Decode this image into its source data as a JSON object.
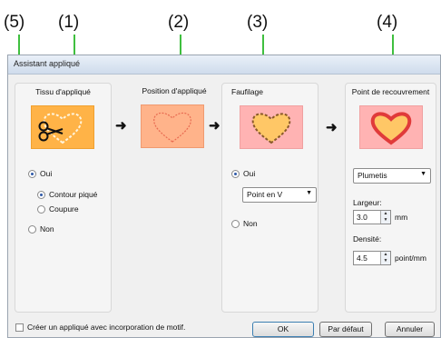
{
  "callouts": [
    "(5)",
    "(1)",
    "(2)",
    "(3)",
    "(4)"
  ],
  "window": {
    "title": "Assistant appliqué"
  },
  "panels": {
    "tissu": {
      "title": "Tissu d'appliqué",
      "radio_oui": "Oui",
      "radio_contour": "Contour piqué",
      "radio_coupure": "Coupure",
      "radio_non": "Non"
    },
    "position": {
      "title": "Position d'appliqué"
    },
    "faufilage": {
      "title": "Faufilage",
      "radio_oui": "Oui",
      "select_value": "Point en V",
      "radio_non": "Non"
    },
    "recouvrement": {
      "title": "Point de recouvrement",
      "select_value": "Plumetis",
      "largeur_label": "Largeur:",
      "largeur_value": "3.0",
      "largeur_unit": "mm",
      "densite_label": "Densité:",
      "densite_value": "4.5",
      "densite_unit": "point/mm"
    }
  },
  "footer": {
    "checkbox_label": "Créer un appliqué avec incorporation de motif.",
    "ok": "OK",
    "default": "Par défaut",
    "cancel": "Annuler"
  },
  "colors": {
    "callout_line": "#3fbf3f",
    "accent_orange": "#ffb347",
    "heart_red": "#e03a3a"
  },
  "icons": [
    "scissors-icon",
    "heart-outline-icon",
    "heart-dashed-icon",
    "heart-filled-icon",
    "arrow-right-icon",
    "dropdown-caret-icon",
    "spin-up-icon",
    "spin-down-icon"
  ]
}
